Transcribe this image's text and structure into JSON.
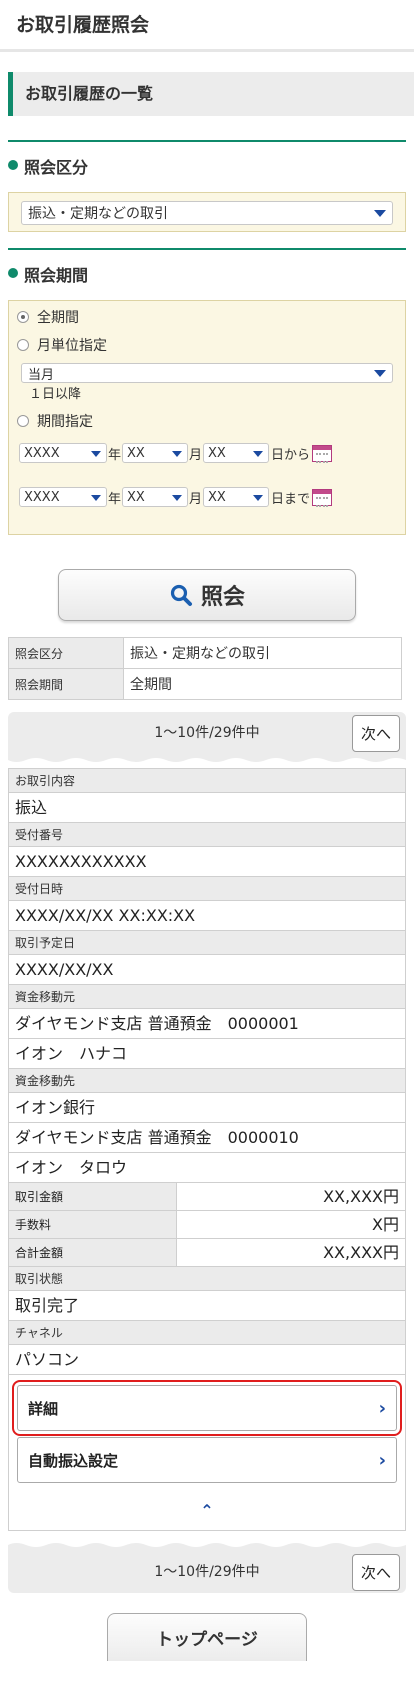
{
  "header": {
    "title": "お取引履歴照会"
  },
  "list_section": {
    "title": "お取引履歴の一覧"
  },
  "query_type": {
    "title": "照会区分",
    "selected": "振込・定期などの取引"
  },
  "query_period": {
    "title": "照会期間",
    "options": {
      "all": "全期間",
      "monthly": "月単位指定",
      "range": "期間指定"
    },
    "month_selected": "当月",
    "month_note": "１日以降",
    "from": {
      "year": "XXXX",
      "year_unit": "年",
      "month": "XX",
      "month_unit": "月",
      "day": "XX",
      "day_suffix": "日から"
    },
    "to": {
      "year": "XXXX",
      "year_unit": "年",
      "month": "XX",
      "month_unit": "月",
      "day": "XX",
      "day_suffix": "日まで"
    }
  },
  "search_button": {
    "label": "照会"
  },
  "summary": {
    "rows": [
      {
        "label": "照会区分",
        "value": "振込・定期などの取引"
      },
      {
        "label": "照会期間",
        "value": "全期間"
      }
    ]
  },
  "pager": {
    "count": "1〜10件/29件中",
    "next": "次へ"
  },
  "detail": {
    "type_label": "お取引内容",
    "type_value": "振込",
    "receipt_no_label": "受付番号",
    "receipt_no_value": "XXXXXXXXXXXX",
    "received_label": "受付日時",
    "received_value": "XXXX/XX/XX XX:XX:XX",
    "scheduled_label": "取引予定日",
    "scheduled_value": "XXXX/XX/XX",
    "from_label": "資金移動元",
    "from_branch": "ダイヤモンド支店 普通預金　0000001",
    "from_name": "イオン　ハナコ",
    "to_label": "資金移動先",
    "to_bank": "イオン銀行",
    "to_branch": "ダイヤモンド支店 普通預金　0000010",
    "to_name": "イオン　タロウ",
    "amount_label": "取引金額",
    "amount_value": "XX,XXX円",
    "fee_label": "手数料",
    "fee_value": "X円",
    "total_label": "合計金額",
    "total_value": "XX,XXX円",
    "status_label": "取引状態",
    "status_value": "取引完了",
    "channel_label": "チャネル",
    "channel_value": "パソコン"
  },
  "links": {
    "detail": "詳細",
    "auto_transfer": "自動振込設定"
  },
  "footer": {
    "top_button": "トップページ"
  },
  "colors": {
    "accent": "#0f8a6b",
    "link": "#1b4aa0",
    "highlight": "#e01d1d",
    "panel": "#fbf7e3"
  }
}
